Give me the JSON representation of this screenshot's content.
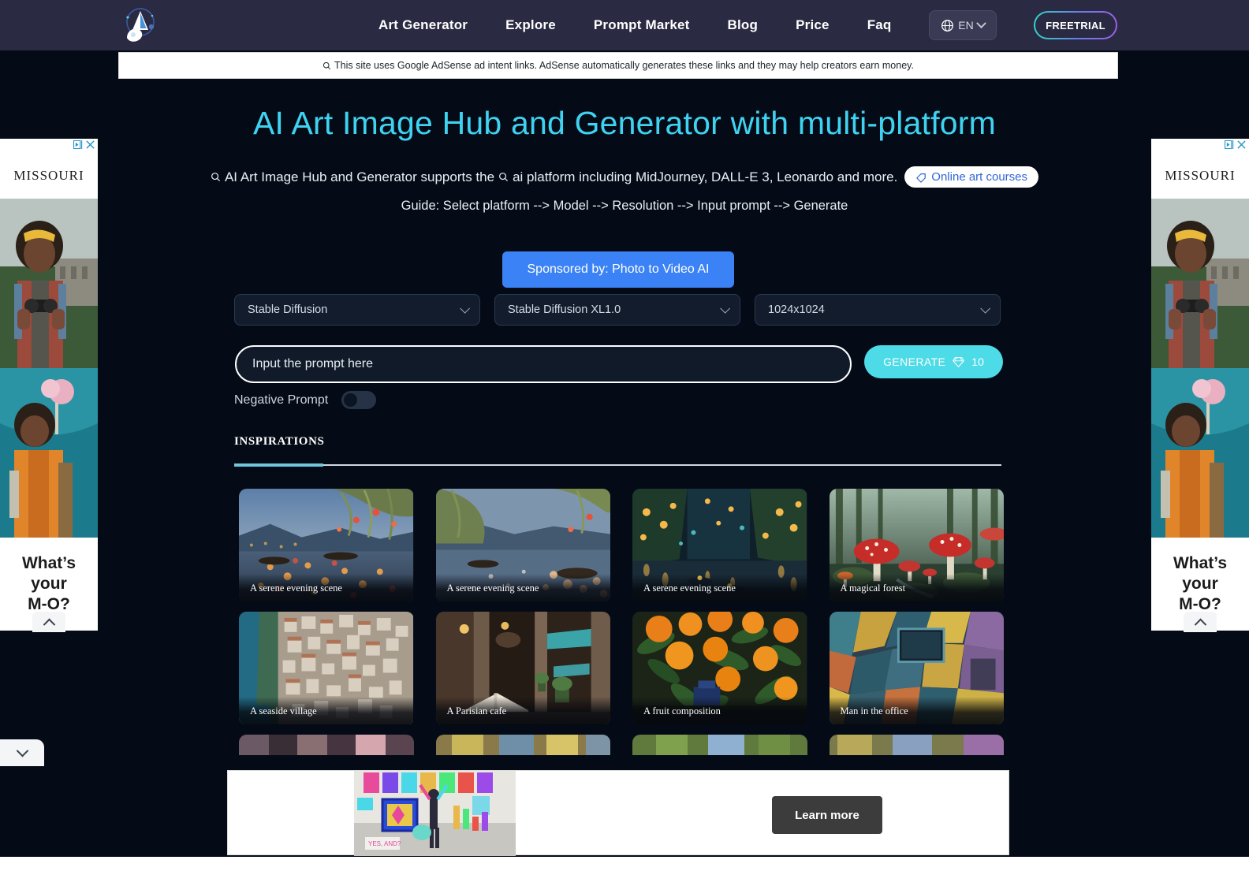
{
  "navbar": {
    "logo_name": "rocket-logo",
    "links": [
      {
        "label": "Art Generator"
      },
      {
        "label": "Explore"
      },
      {
        "label": "Prompt Market"
      },
      {
        "label": "Blog"
      },
      {
        "label": "Price"
      },
      {
        "label": "Faq"
      }
    ],
    "language": {
      "label": "EN",
      "icon": "globe-icon"
    },
    "free_trial": "FREETRIAL"
  },
  "adsense_notice": "This site uses Google AdSense ad intent links. AdSense automatically generates these links and they may help creators earn money.",
  "hero": {
    "title": "AI Art Image Hub and Generator with multi-platform",
    "subtitle_part1": "AI Art Image Hub and Generator supports the",
    "subtitle_part2": "ai platform including MidJourney, DALL-E 3, Leonardo and more.",
    "courses_pill": "Online art courses",
    "guide": "Guide: Select platform --> Model --> Resolution --> Input prompt --> Generate"
  },
  "sponsor": {
    "label": "Sponsored by: Photo to Video AI",
    "color": "#3b82f6"
  },
  "controls": {
    "platform": {
      "value": "Stable Diffusion"
    },
    "model": {
      "value": "Stable Diffusion XL1.0"
    },
    "resolution": {
      "value": "1024x1024"
    },
    "prompt": {
      "placeholder": "Input the prompt here",
      "value": ""
    },
    "generate": {
      "label": "GENERATE",
      "credits": "10",
      "icon": "gem-icon",
      "color": "#4ddbe8"
    },
    "negative_prompt": {
      "label": "Negative Prompt",
      "enabled": false
    }
  },
  "inspirations": {
    "title": "INSPIRATIONS",
    "rows": [
      [
        {
          "caption": "A serene evening scene",
          "art": "lantern-river-1"
        },
        {
          "caption": "A serene evening scene",
          "art": "lantern-river-2"
        },
        {
          "caption": "A serene evening scene",
          "art": "lantern-river-3"
        },
        {
          "caption": "A magical forest",
          "art": "mushroom-forest"
        }
      ],
      [
        {
          "caption": "A seaside village",
          "art": "cliff-village"
        },
        {
          "caption": "A Parisian cafe",
          "art": "paris-cafe"
        },
        {
          "caption": "A fruit composition",
          "art": "oranges"
        },
        {
          "caption": "Man in the office",
          "art": "abstract-office"
        }
      ]
    ],
    "row3_partial": [
      "portrait-row",
      "abstract-yellow",
      "green-field",
      "purple-field"
    ]
  },
  "side_ad": {
    "brand": "MISSOURI",
    "tagline_lines": [
      "What’s",
      "your",
      "M-O?"
    ],
    "adchoices_icon": "adchoices-icon",
    "close_icon": "close-icon",
    "collapse_icon": "chevron-up-icon"
  },
  "bottom_ad": {
    "cta": "Learn more"
  },
  "bottom_tab": {
    "icon": "chevron-down-icon"
  },
  "colors": {
    "page_bg": "#050b16",
    "nav_bg": "#2a2a42",
    "accent_cyan": "#3fd3f2",
    "generate": "#4ddbe8",
    "sponsor_blue": "#3b82f6"
  }
}
